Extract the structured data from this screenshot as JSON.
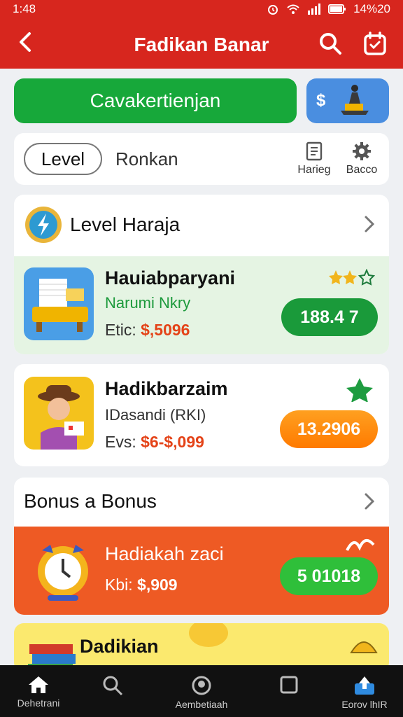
{
  "status": {
    "time": "1:48",
    "battery": "14%20"
  },
  "header": {
    "title": "Fadikan Banar",
    "back_label": "<"
  },
  "promo": {
    "main_label": "Cavakertienjan",
    "side_label": "$"
  },
  "tabs": {
    "active": "Level",
    "other": "Ronkan",
    "tool1": "Harieg",
    "tool2": "Bacco"
  },
  "level_section": {
    "title": "Level Haraja",
    "items": [
      {
        "name": "Hauiabparyani",
        "sub": "Narumi Nkry",
        "price_prefix": "Etic:",
        "price": "$,5096",
        "button": "188.4 7",
        "sub_color": "#1d9a3c"
      },
      {
        "name": "Hadikbarzaim",
        "sub": "IDasandi (RKI)",
        "price_prefix": "Evs:",
        "price": "$6-$,099",
        "button": "13.2906"
      }
    ]
  },
  "bonus_section": {
    "title": "Bonus a Bonus",
    "items": [
      {
        "name": "Hadiakah zaci",
        "price_prefix": "Kbi:",
        "price": "$,909",
        "button": "5 01018"
      },
      {
        "name": "Dadikian"
      }
    ]
  },
  "bottom_nav": [
    {
      "label": "Dehetrani",
      "icon": "home-icon"
    },
    {
      "label": "",
      "icon": "search-icon"
    },
    {
      "label": "Aembetiaah",
      "icon": "globe-icon"
    },
    {
      "label": "",
      "icon": "square-icon"
    },
    {
      "label": "Eorov lhIR",
      "icon": "upload-icon"
    }
  ],
  "colors": {
    "brand_red": "#d7261e",
    "green": "#17a83a",
    "orange": "#ff8a00",
    "bonus_orange": "#ee5a24"
  }
}
